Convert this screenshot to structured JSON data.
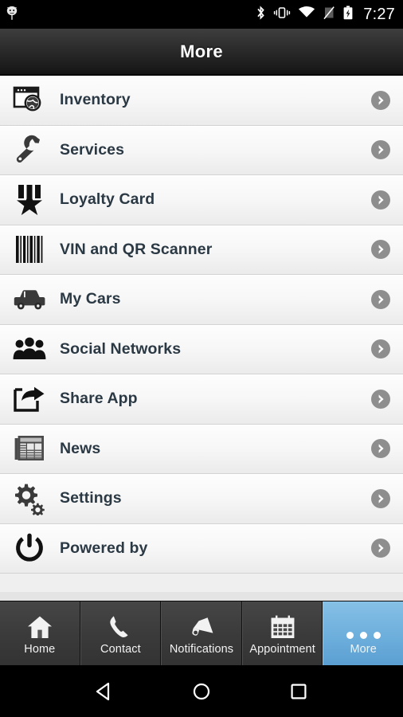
{
  "status_bar": {
    "time": "7:27",
    "left_icons": [
      {
        "name": "app-notification-icon",
        "glyph": "android-head"
      }
    ],
    "right_icons": [
      {
        "name": "bluetooth-icon"
      },
      {
        "name": "vibrate-mode-icon"
      },
      {
        "name": "wifi-icon"
      },
      {
        "name": "no-sim-icon"
      },
      {
        "name": "battery-charging-icon"
      }
    ]
  },
  "header": {
    "title": "More"
  },
  "menu": {
    "items": [
      {
        "label": "Inventory",
        "icon": "browser-globe-icon"
      },
      {
        "label": "Services",
        "icon": "wrench-icon"
      },
      {
        "label": "Loyalty Card",
        "icon": "medal-star-icon"
      },
      {
        "label": "VIN and QR Scanner",
        "icon": "barcode-icon"
      },
      {
        "label": "My Cars",
        "icon": "car-icon"
      },
      {
        "label": "Social Networks",
        "icon": "people-group-icon"
      },
      {
        "label": "Share App",
        "icon": "share-arrow-icon"
      },
      {
        "label": "News",
        "icon": "newspaper-icon"
      },
      {
        "label": "Settings",
        "icon": "gears-icon"
      },
      {
        "label": "Powered by",
        "icon": "power-button-icon"
      }
    ],
    "chevron_icon": "chevron-right-circle-icon"
  },
  "tab_bar": {
    "tabs": [
      {
        "label": "Home",
        "icon": "house-icon",
        "active": false
      },
      {
        "label": "Contact",
        "icon": "phone-icon",
        "active": false
      },
      {
        "label": "Notifications",
        "icon": "megaphone-icon",
        "active": false
      },
      {
        "label": "Appointment",
        "icon": "calendar-icon",
        "active": false
      },
      {
        "label": "More",
        "icon": "three-dots-icon",
        "active": true
      }
    ],
    "active_color": "#6fb0dd"
  },
  "nav_bar": {
    "buttons": [
      {
        "name": "back-button",
        "icon": "triangle-left-icon"
      },
      {
        "name": "home-button",
        "icon": "circle-icon"
      },
      {
        "name": "recents-button",
        "icon": "square-icon"
      }
    ]
  },
  "colors": {
    "label_text": "#2b3944",
    "row_bg_top": "#fdfdfd",
    "row_bg_bottom": "#ebebeb",
    "chevron": "#8e8e8e",
    "tab_active": "#6fb0dd"
  }
}
